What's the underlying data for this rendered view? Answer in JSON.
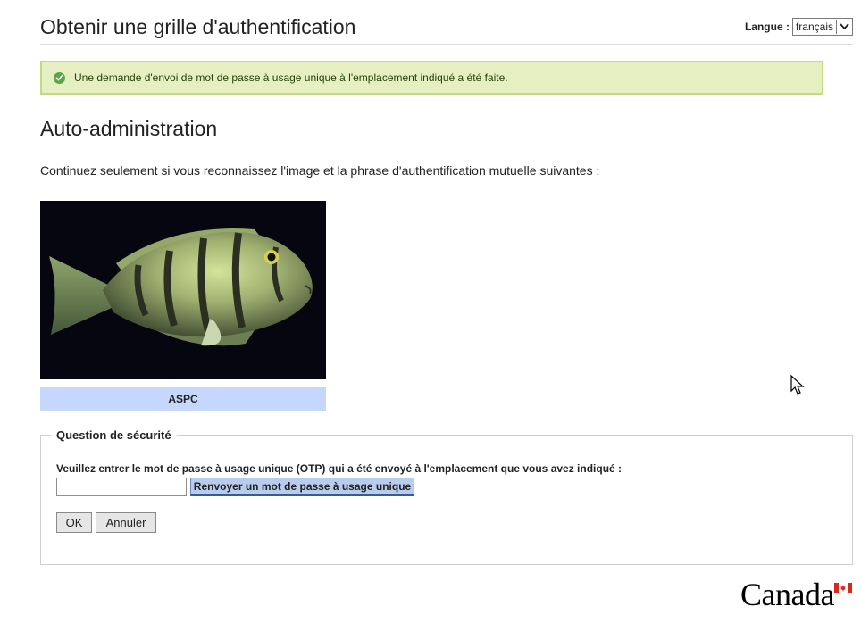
{
  "header": {
    "title": "Obtenir une grille d'authentification",
    "language_label": "Langue :",
    "language_value": "français"
  },
  "notice": {
    "text": "Une demande d'envoi de mot de passe à usage unique à l'emplacement indiqué a été faite."
  },
  "section": {
    "title": "Auto-administration",
    "intro": "Continuez seulement si vous reconnaissez l'image et la phrase d'authentification mutuelle suivantes :",
    "image_caption": "ASPC"
  },
  "security": {
    "legend": "Question de sécurité",
    "prompt": "Veuillez entrer le mot de passe à usage unique (OTP) qui a été envoyé à l'emplacement que vous avez indiqué :",
    "otp_value": "",
    "resend_label": "Renvoyer un mot de passe à usage unique",
    "ok_label": "OK",
    "cancel_label": "Annuler"
  },
  "footer": {
    "wordmark": "Canada"
  },
  "colors": {
    "notice_bg": "#e6efc2",
    "notice_border": "#c6d880",
    "caption_bg": "#c5d8fb",
    "resend_bg": "#b8cdee"
  },
  "icons": {
    "notice": "check-circle-icon",
    "language_dropdown": "chevron-down-icon",
    "flag": "canada-flag-icon",
    "cursor": "mouse-pointer-icon"
  }
}
